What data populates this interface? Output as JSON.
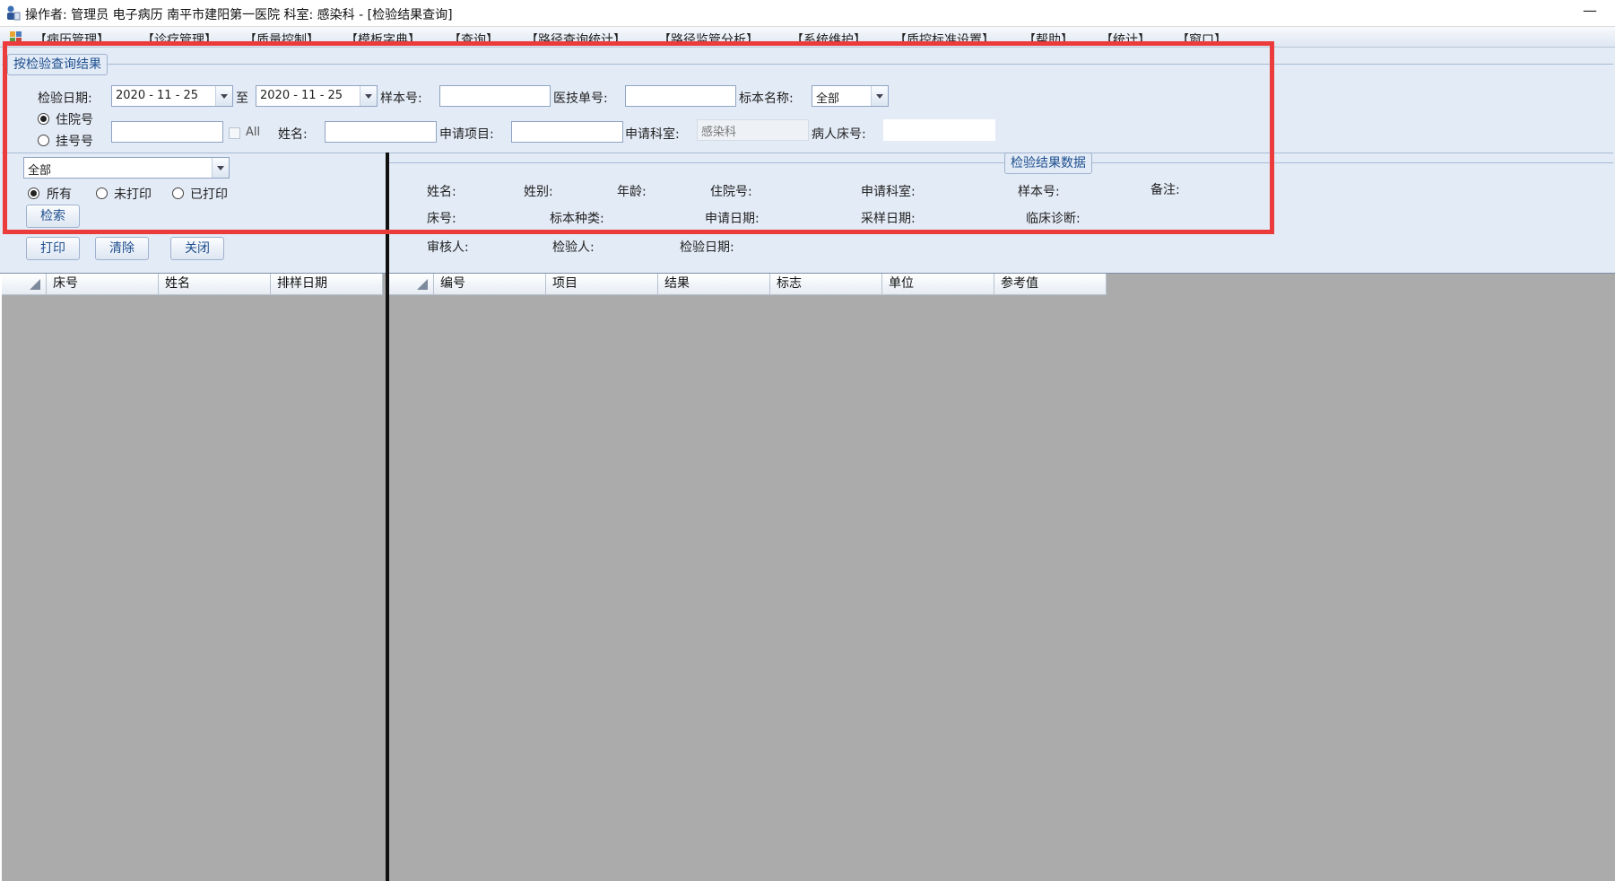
{
  "window": {
    "title": "操作者: 管理员 电子病历  南平市建阳第一医院  科室: 感染科 - [检验结果查询]",
    "minimize": "—"
  },
  "menu": {
    "items": [
      "【病历管理】",
      "【诊疗管理】",
      "【质量控制】",
      "【模板字典】",
      "【查询】",
      "【路径查询统计】",
      "【路径监管分析】",
      "【系统维护】",
      "【质控标准设置】",
      "【帮助】",
      "【统计】",
      "【窗口】"
    ]
  },
  "query": {
    "group_title": "按检验查询结果",
    "date_label": "检验日期:",
    "date_from": "2020 - 11 - 25",
    "to_label": "至",
    "date_to": "2020 - 11 - 25",
    "sample_no_label": "样本号:",
    "sample_no": "",
    "lab_order_label": "医技单号:",
    "lab_order": "",
    "specimen_name_label": "标本名称:",
    "specimen_name": "全部",
    "inpatient_radio": "住院号",
    "registration_radio": "挂号号",
    "patient_no": "",
    "all_checkbox": "All",
    "name_label": "姓名:",
    "name": "",
    "request_item_label": "申请项目:",
    "request_item": "",
    "request_dept_label": "申请科室:",
    "request_dept": "感染科",
    "bed_no_label": "病人床号:",
    "bed_no": ""
  },
  "filter": {
    "category": "全部",
    "radio_all": "所有",
    "radio_unprinted": "未打印",
    "radio_printed": "已打印",
    "search_button": "检索",
    "print_button": "打印",
    "clear_button": "清除",
    "close_button": "关闭"
  },
  "result_info": {
    "group_title": "检验结果数据",
    "name_label": "姓名:",
    "sex_label": "姓别:",
    "age_label": "年龄:",
    "inpatient_label": "住院号:",
    "request_dept_label": "申请科室:",
    "sample_label": "样本号:",
    "remark_label": "备注:",
    "bed_label": "床号:",
    "specimen_type_label": "标本种类:",
    "request_date_label": "申请日期:",
    "sampling_date_label": "采样日期:",
    "diagnosis_label": "临床诊断:",
    "reviewer_label": "审核人:",
    "examiner_label": "检验人:",
    "exam_date_label": "检验日期:"
  },
  "left_grid": {
    "columns": [
      "床号",
      "姓名",
      "排样日期"
    ]
  },
  "right_grid": {
    "columns": [
      "编号",
      "项目",
      "结果",
      "标志",
      "单位",
      "参考值"
    ]
  },
  "colors": {
    "panel": "#e3ebf6",
    "highlight": "#ec3b3b",
    "grid_bg": "#ababab"
  }
}
